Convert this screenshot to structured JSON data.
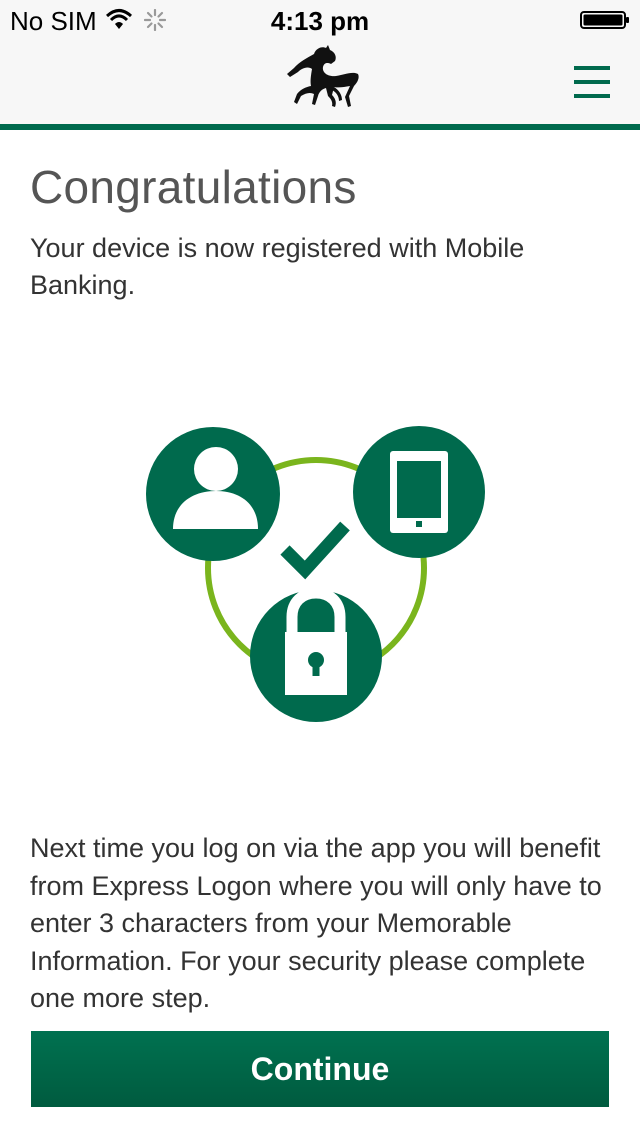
{
  "status_bar": {
    "carrier": "No SIM",
    "time": "4:13 pm"
  },
  "header": {
    "logo": "black-horse-logo-icon",
    "menu": "hamburger-menu-icon"
  },
  "colors": {
    "brand_green": "#006a4d",
    "ring_green": "#7ab51d",
    "title_grey": "#555555"
  },
  "main": {
    "title": "Congratulations",
    "intro": "Your device is now registered with Mobile Banking.",
    "info": "Next time you log on via the app you will benefit from Express Logon where you will only have to enter 3 characters from your Memorable Information. For your security please complete one more step.",
    "continue_label": "Continue"
  },
  "illustration": {
    "icons": [
      "person-icon",
      "mobile-phone-icon",
      "padlock-icon",
      "checkmark-icon"
    ]
  }
}
